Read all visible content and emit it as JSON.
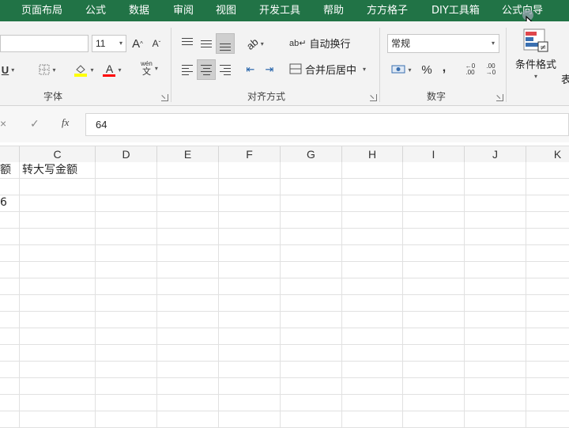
{
  "ribbon_tabs": [
    "页面布局",
    "公式",
    "数据",
    "审阅",
    "视图",
    "开发工具",
    "帮助",
    "方方格子",
    "DIY工具箱",
    "公式向导"
  ],
  "font": {
    "size": "11",
    "grow_label": "A",
    "shrink_label": "A",
    "underline_label": "U",
    "font_color_label": "A",
    "phonetic_label": "wén",
    "phonetic_sub": "文"
  },
  "alignment": {
    "wrap_text_label": "自动换行",
    "merge_center_label": "合并后居中"
  },
  "number": {
    "format_value": "常规",
    "percent_label": "%",
    "comma_label": ","
  },
  "styles": {
    "conditional_format_label": "条件格式",
    "table_partial": "表"
  },
  "group_labels": {
    "font": "字体",
    "alignment": "对齐方式",
    "number": "数字"
  },
  "formula_bar": {
    "cancel_glyph": "×",
    "enter_glyph": "✓",
    "fx_label": "fx",
    "value": "64"
  },
  "columns": [
    "C",
    "D",
    "E",
    "F",
    "G",
    "H",
    "I",
    "J",
    "K"
  ],
  "cells": {
    "b_header_partial": "额",
    "c_header": "转大写金额",
    "b_value_partial": "6"
  },
  "colors": {
    "tab_bar": "#217346",
    "ribbon": "#f3f3f3",
    "highlight": "#ffff00",
    "font_color": "#ff0000"
  }
}
